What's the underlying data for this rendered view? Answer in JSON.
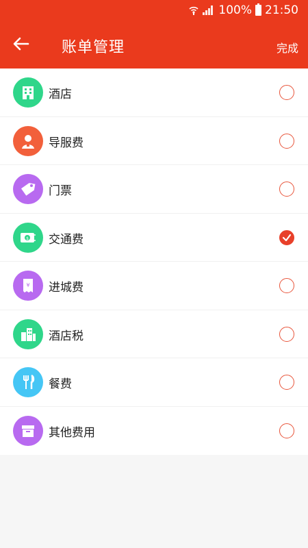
{
  "status": {
    "battery": "100%",
    "time": "21:50"
  },
  "header": {
    "title": "账单管理",
    "done_label": "完成"
  },
  "colors": {
    "brand": "#ea3a1d",
    "radio": "#e8543a"
  },
  "items": [
    {
      "label": "酒店",
      "icon": "hotel-icon",
      "color": "#2fd68a",
      "checked": false
    },
    {
      "label": "导服费",
      "icon": "guide-icon",
      "color": "#f2603b",
      "checked": false
    },
    {
      "label": "门票",
      "icon": "ticket-tag-icon",
      "color": "#b86af0",
      "checked": false
    },
    {
      "label": "交通费",
      "icon": "money-icon",
      "color": "#2fd68a",
      "checked": true
    },
    {
      "label": "进城费",
      "icon": "receipt-icon",
      "color": "#b86af0",
      "checked": false
    },
    {
      "label": "酒店税",
      "icon": "buildings-icon",
      "color": "#2fd68a",
      "checked": false
    },
    {
      "label": "餐费",
      "icon": "cutlery-icon",
      "color": "#45c6f5",
      "checked": false
    },
    {
      "label": "其他费用",
      "icon": "box-icon",
      "color": "#b86af0",
      "checked": false
    }
  ]
}
